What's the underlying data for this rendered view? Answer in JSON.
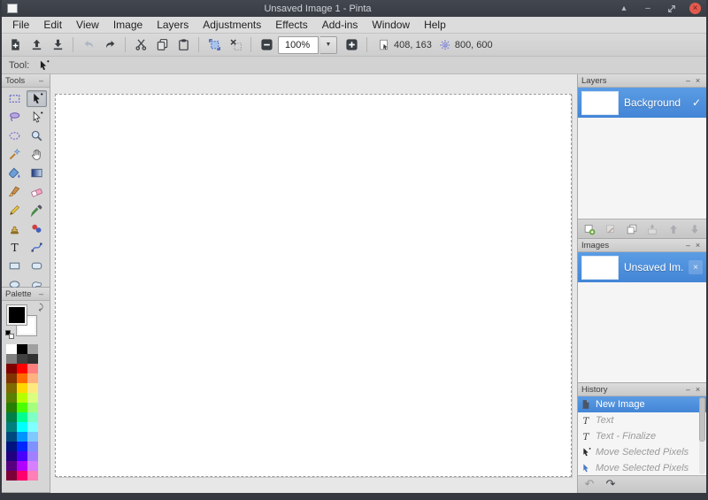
{
  "window": {
    "title": "Unsaved Image 1 - Pinta",
    "controls": {
      "shade": "shade",
      "minimize": "minimize",
      "maximize": "maximize",
      "close": "close"
    }
  },
  "menu": {
    "items": [
      "File",
      "Edit",
      "View",
      "Image",
      "Layers",
      "Adjustments",
      "Effects",
      "Add-ins",
      "Window",
      "Help"
    ]
  },
  "toolbar": {
    "buttons": [
      {
        "icon": "new-image",
        "label": "New image",
        "enabled": true
      },
      {
        "icon": "open",
        "label": "Open",
        "enabled": true
      },
      {
        "icon": "save",
        "label": "Save",
        "enabled": true
      },
      {
        "sep": true
      },
      {
        "icon": "undo",
        "label": "Undo",
        "enabled": false
      },
      {
        "icon": "redo",
        "label": "Redo",
        "enabled": true
      },
      {
        "sep": true
      },
      {
        "icon": "cut",
        "label": "Cut",
        "enabled": true
      },
      {
        "icon": "copy",
        "label": "Copy",
        "enabled": true
      },
      {
        "icon": "paste",
        "label": "Paste",
        "enabled": true
      },
      {
        "sep": true
      },
      {
        "icon": "crop",
        "label": "Crop to selection",
        "enabled": true
      },
      {
        "icon": "deselect",
        "label": "Deselect",
        "enabled": true
      },
      {
        "sep": true
      }
    ],
    "zoom": {
      "out_label": "Zoom out",
      "value": "100%",
      "in_label": "Zoom in"
    },
    "cursor_position": "408, 163",
    "image_size": "800, 600"
  },
  "tool_row": {
    "label": "Tool:",
    "current_tool": "Move Selected Pixels"
  },
  "tools_panel": {
    "title": "Tools",
    "selected": "Move Selected Pixels",
    "tools": [
      {
        "name": "Rectangle Select",
        "icon": "rect-select"
      },
      {
        "name": "Move Selected Pixels",
        "icon": "move-selected"
      },
      {
        "name": "Lasso Select",
        "icon": "lasso-select"
      },
      {
        "name": "Move Selection",
        "icon": "move-selection"
      },
      {
        "name": "Ellipse Select",
        "icon": "ellipse-select"
      },
      {
        "name": "Zoom",
        "icon": "zoom-tool"
      },
      {
        "name": "Magic Wand",
        "icon": "magic-wand"
      },
      {
        "name": "Pan",
        "icon": "pan"
      },
      {
        "name": "Paint Bucket",
        "icon": "paint-bucket"
      },
      {
        "name": "Gradient",
        "icon": "gradient"
      },
      {
        "name": "Paintbrush",
        "icon": "paintbrush"
      },
      {
        "name": "Eraser",
        "icon": "eraser"
      },
      {
        "name": "Pencil",
        "icon": "pencil"
      },
      {
        "name": "Color Picker",
        "icon": "color-picker"
      },
      {
        "name": "Clone Stamp",
        "icon": "clone-stamp"
      },
      {
        "name": "Recolor",
        "icon": "recolor"
      },
      {
        "name": "Text",
        "icon": "text"
      },
      {
        "name": "Line/Curve",
        "icon": "line-curve"
      },
      {
        "name": "Rectangle",
        "icon": "rectangle"
      },
      {
        "name": "Rounded Rectangle",
        "icon": "rounded-rectangle"
      },
      {
        "name": "Ellipse",
        "icon": "ellipse"
      },
      {
        "name": "Freeform Shape",
        "icon": "freeform"
      }
    ]
  },
  "palette_panel": {
    "title": "Palette",
    "primary_color": "#000000",
    "secondary_color": "#ffffff",
    "swatches": [
      "#FFFFFF",
      "#000000",
      "#A0A0A0",
      "#808080",
      "#404040",
      "#303030",
      "#7F0000",
      "#FF0000",
      "#FF7F7F",
      "#7F3300",
      "#FF6A00",
      "#FFB27F",
      "#7F6A00",
      "#FFD800",
      "#FFE97F",
      "#5B7F00",
      "#B6FF00",
      "#DAFF7F",
      "#267F00",
      "#4CFF00",
      "#A5FF7F",
      "#007F46",
      "#00FF90",
      "#7FFFC5",
      "#007F7F",
      "#00FFFF",
      "#7FFFFF",
      "#00497F",
      "#0094FF",
      "#7FC9FF",
      "#00137F",
      "#0026FF",
      "#7F92FF",
      "#21007F",
      "#4800FF",
      "#A17FFF",
      "#57007F",
      "#B200FF",
      "#D67FFF",
      "#7F0037",
      "#FF006E",
      "#FF7FB6"
    ]
  },
  "layers_panel": {
    "title": "Layers",
    "layers": [
      {
        "name": "Background",
        "visible": true,
        "selected": true
      }
    ],
    "footer_buttons": [
      {
        "icon": "layer-add",
        "label": "Add layer",
        "enabled": true
      },
      {
        "icon": "layer-delete",
        "label": "Delete layer",
        "enabled": false
      },
      {
        "icon": "layer-duplicate",
        "label": "Duplicate layer",
        "enabled": true
      },
      {
        "icon": "layer-merge",
        "label": "Merge layer down",
        "enabled": false
      },
      {
        "icon": "layer-up",
        "label": "Move layer up",
        "enabled": false
      },
      {
        "icon": "layer-down",
        "label": "Move layer down",
        "enabled": false
      }
    ]
  },
  "images_panel": {
    "title": "Images",
    "images": [
      {
        "name": "Unsaved Im...",
        "selected": true
      }
    ]
  },
  "history_panel": {
    "title": "History",
    "items": [
      {
        "label": "New Image",
        "icon": "hist-new",
        "state": "current"
      },
      {
        "label": "Text",
        "icon": "hist-text",
        "state": "undone"
      },
      {
        "label": "Text - Finalize",
        "icon": "hist-text",
        "state": "undone"
      },
      {
        "label": "Move Selected Pixels",
        "icon": "hist-move",
        "state": "undone"
      },
      {
        "label": "Move Selected Pixels",
        "icon": "hist-move-blue",
        "state": "undone"
      }
    ],
    "undo_enabled": false,
    "redo_enabled": true
  },
  "colors": {
    "selection_blue": "#4385d6",
    "titlebar": "#3c4049",
    "close_button": "#e25a4e",
    "canvas": "#ffffff"
  }
}
